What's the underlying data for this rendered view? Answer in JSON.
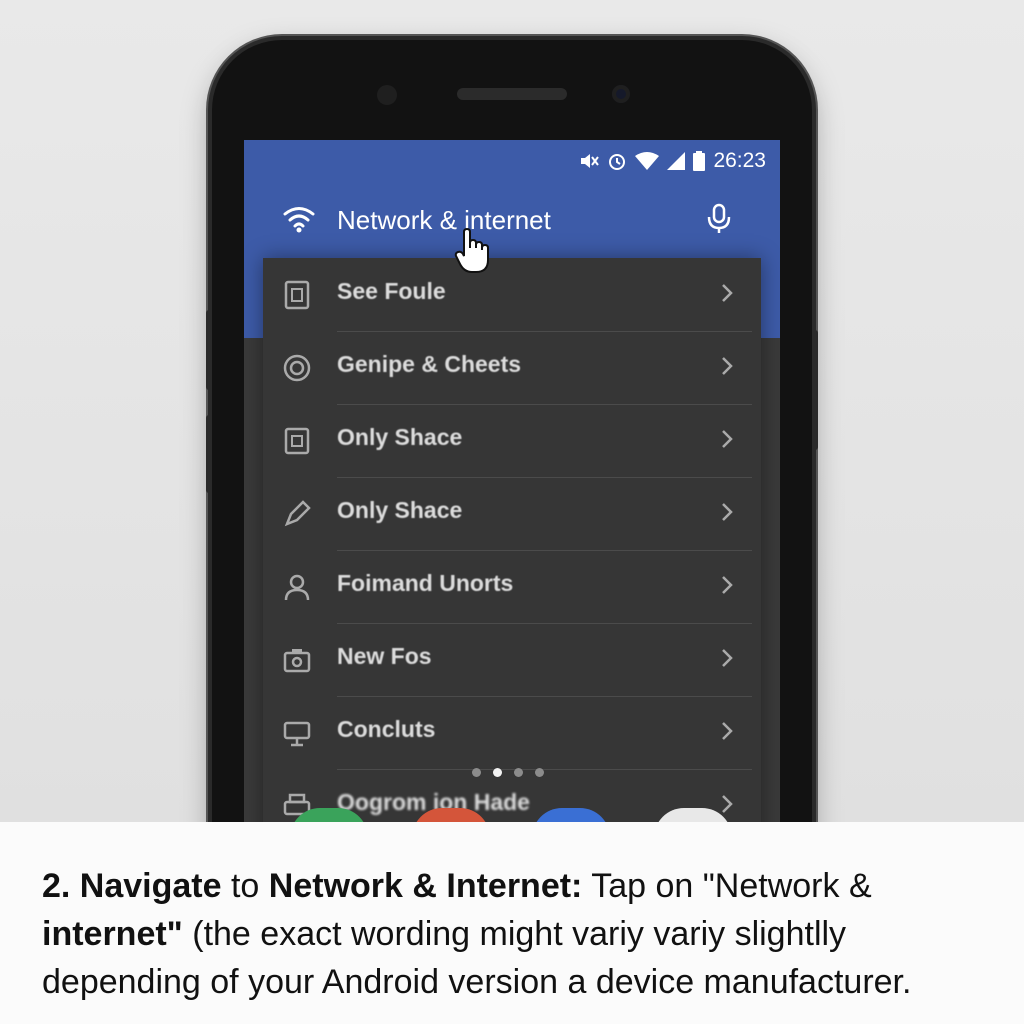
{
  "status_bar": {
    "icons": [
      "mute-icon",
      "alarm-icon",
      "wifi-icon",
      "signal-icon",
      "battery-icon"
    ],
    "time": "26:23"
  },
  "header": {
    "title": "Network & internet",
    "icon": "wifi-icon",
    "action_icon": "mic-icon"
  },
  "menu": {
    "items": [
      {
        "label": "See Foule",
        "icon": "sim-icon"
      },
      {
        "label": "Genipe & Cheets",
        "icon": "target-icon"
      },
      {
        "label": "Only Shace",
        "icon": "storage-icon"
      },
      {
        "label": "Only Shace",
        "icon": "pen-icon"
      },
      {
        "label": "Foimand Unorts",
        "icon": "person-icon"
      },
      {
        "label": "New Fos",
        "icon": "camera-icon"
      },
      {
        "label": "Concluts",
        "icon": "display-icon"
      },
      {
        "label": "Oogrom ion Hade",
        "icon": "printer-icon"
      }
    ]
  },
  "pager": {
    "count": 4,
    "active": 2
  },
  "colors": {
    "accent": "#3d5ba8",
    "panel": "#363636",
    "dock": [
      "#3aa35b",
      "#d4553a",
      "#3a6fd4",
      "#e8e8e8"
    ]
  },
  "caption": {
    "step": "2. Navigate",
    "to": " to ",
    "target": "Network & Internet:",
    "instruction": " Tap on \"Network & ",
    "quoted": "internet\"",
    "rest": " (the exact wording might variy variy slightlly depending of your Android version a  device manufacturer."
  }
}
